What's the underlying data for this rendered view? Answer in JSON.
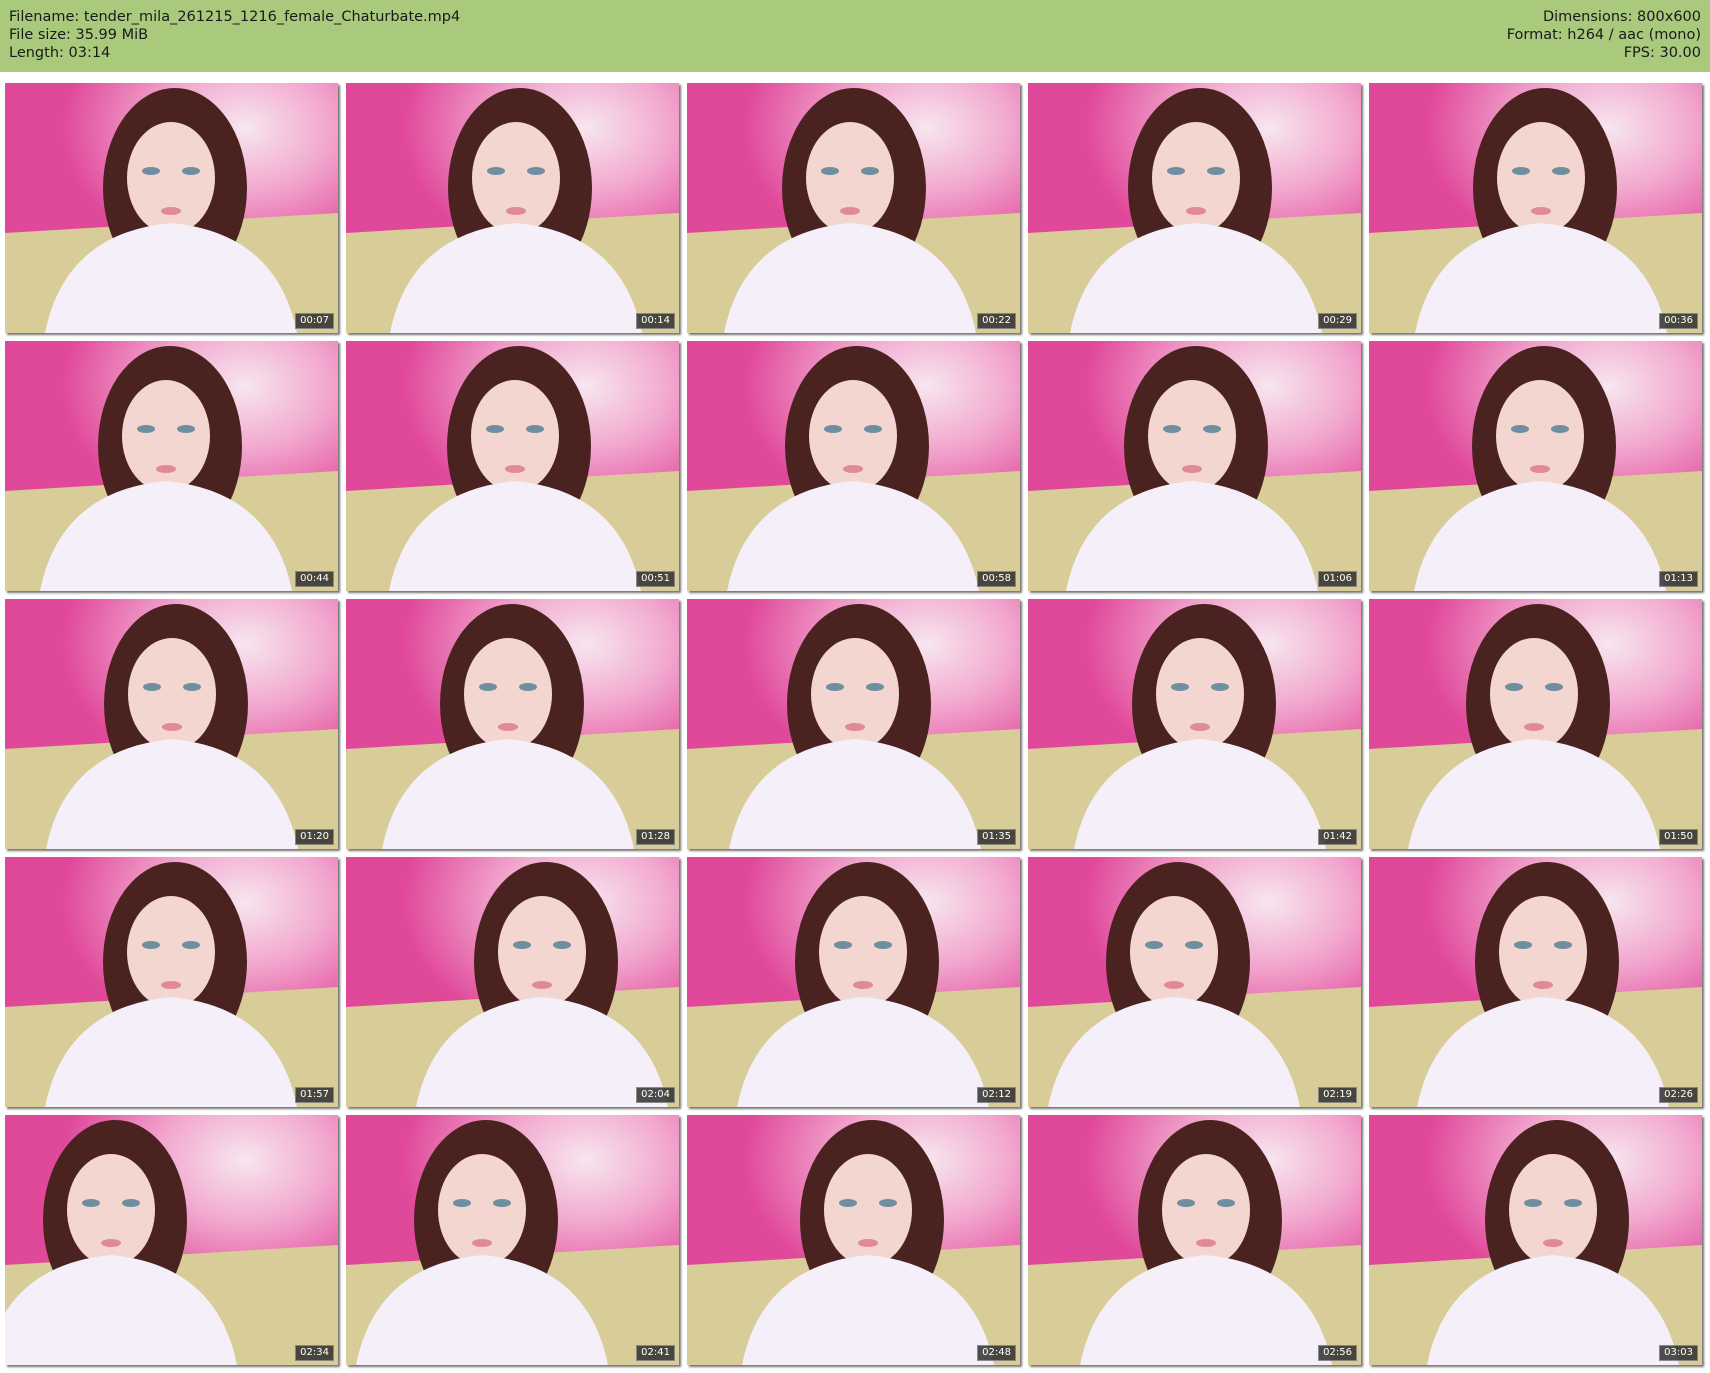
{
  "header": {
    "filename": "Filename: tender_mila_261215_1216_female_Chaturbate.mp4",
    "filesize": "File size: 35.99 MiB",
    "length": "Length: 03:14",
    "dimensions": "Dimensions: 800x600",
    "format": "Format: h264 / aac (mono)",
    "fps": "FPS: 30.00",
    "background": "#a9c97c"
  },
  "thumbnails": [
    {
      "time": "00:07"
    },
    {
      "time": "00:14"
    },
    {
      "time": "00:22"
    },
    {
      "time": "00:29"
    },
    {
      "time": "00:36"
    },
    {
      "time": "00:44"
    },
    {
      "time": "00:51"
    },
    {
      "time": "00:58"
    },
    {
      "time": "01:06"
    },
    {
      "time": "01:13"
    },
    {
      "time": "01:20"
    },
    {
      "time": "01:28"
    },
    {
      "time": "01:35"
    },
    {
      "time": "01:42"
    },
    {
      "time": "01:50"
    },
    {
      "time": "01:57"
    },
    {
      "time": "02:04"
    },
    {
      "time": "02:12"
    },
    {
      "time": "02:19"
    },
    {
      "time": "02:26"
    },
    {
      "time": "02:34"
    },
    {
      "time": "02:41"
    },
    {
      "time": "02:48"
    },
    {
      "time": "02:56"
    },
    {
      "time": "03:03"
    }
  ],
  "colors": {
    "wall": "#e0489a",
    "wall_glow": "#f7e6ef",
    "bed": "#d8cc98",
    "hair": "#4a2320",
    "skin": "#f2d6cf",
    "blanket": "#f4eff8"
  }
}
